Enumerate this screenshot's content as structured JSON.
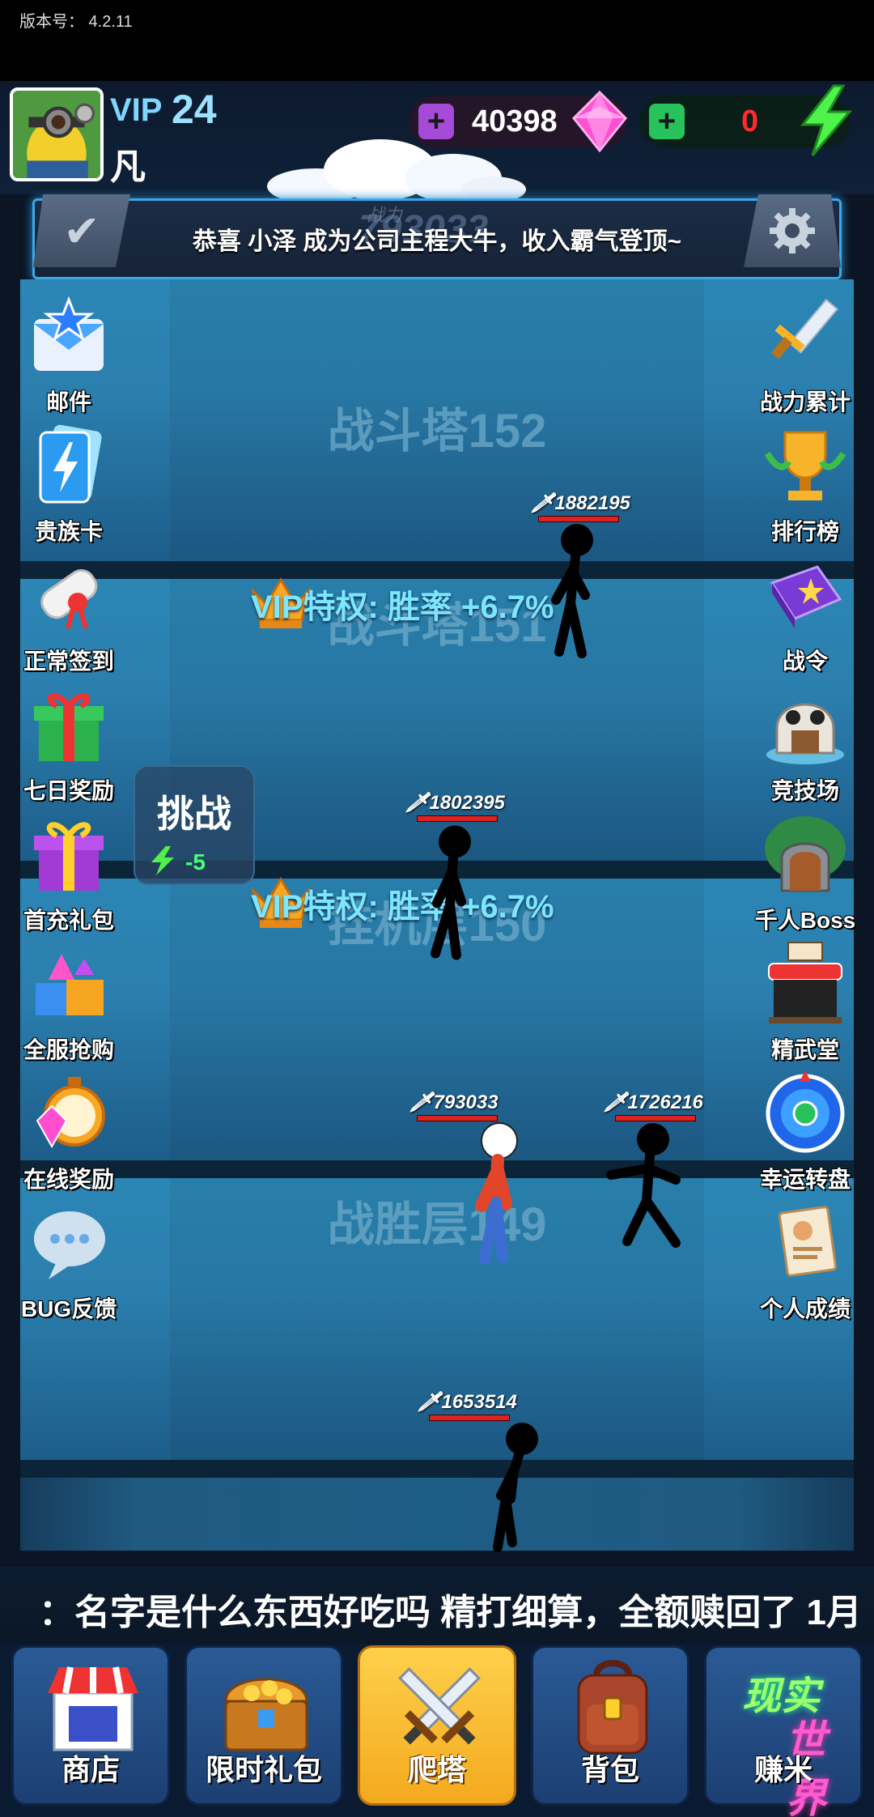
{
  "version_label": "版本号：  4.2.11",
  "player": {
    "vip_label": "VIP",
    "vip_level": "24",
    "name": "凡"
  },
  "currency": {
    "gems": "40398",
    "energy": "0"
  },
  "banner": {
    "message": "恭喜 小泽 成为公司主程大牛，收入霸气登顶~",
    "power_label": "战力",
    "power_value": "793033"
  },
  "left_menu": [
    {
      "label": "邮件",
      "icon": "mail-icon"
    },
    {
      "label": "贵族卡",
      "icon": "noble-card-icon"
    },
    {
      "label": "正常签到",
      "icon": "sign-in-scroll-icon"
    },
    {
      "label": "七日奖励",
      "icon": "gift-box-icon"
    },
    {
      "label": "首充礼包",
      "icon": "first-charge-gift-icon"
    },
    {
      "label": "全服抢购",
      "icon": "treasure-gifts-icon"
    },
    {
      "label": "在线奖励",
      "icon": "stopwatch-gem-icon"
    },
    {
      "label": "BUG反馈",
      "icon": "chat-bubble-icon"
    }
  ],
  "right_menu": [
    {
      "label": "战力累计",
      "icon": "sword-icon"
    },
    {
      "label": "排行榜",
      "icon": "trophy-icon"
    },
    {
      "label": "战令",
      "icon": "book-icon"
    },
    {
      "label": "竞技场",
      "icon": "skull-gate-icon"
    },
    {
      "label": "千人Boss",
      "icon": "boss-gate-icon"
    },
    {
      "label": "精武堂",
      "icon": "dojo-icon"
    },
    {
      "label": "幸运转盘",
      "icon": "wheel-icon"
    },
    {
      "label": "个人成绩",
      "icon": "report-icon"
    }
  ],
  "floors": [
    {
      "name": "战斗塔152",
      "vip_text": "VIP特权: 胜率 +6.7%",
      "enemies": [
        {
          "power": "1882195"
        }
      ]
    },
    {
      "name": "战斗塔151",
      "vip_text": "VIP特权: 胜率 +6.7%",
      "enemies": [
        {
          "power": "1802395"
        }
      ]
    },
    {
      "name": "挂机层150",
      "player_power": "793033",
      "enemies": [
        {
          "power": "1726216"
        }
      ]
    },
    {
      "name": "战胜层149",
      "enemies": [
        {
          "power": "1653514"
        }
      ]
    }
  ],
  "challenge": {
    "title": "挑战",
    "cost": "-5"
  },
  "ticker": "：名字是什么东西好吃吗 精打细算，全额赎回了 1月",
  "bottom_nav": [
    {
      "label": "商店",
      "icon": "shop-icon"
    },
    {
      "label": "限时礼包",
      "icon": "treasure-chest-icon"
    },
    {
      "label": "爬塔",
      "icon": "crossed-swords-icon",
      "active": true
    },
    {
      "label": "背包",
      "icon": "backpack-icon"
    },
    {
      "label": "赚米",
      "icon": "real-world-icon",
      "badge_line1": "现实",
      "badge_line2": "世界"
    }
  ],
  "colors": {
    "accent": "#7de6ff",
    "active_tab": "#f7b52a",
    "energy_value": "#ff2a2a",
    "hp": "#dd2222"
  }
}
